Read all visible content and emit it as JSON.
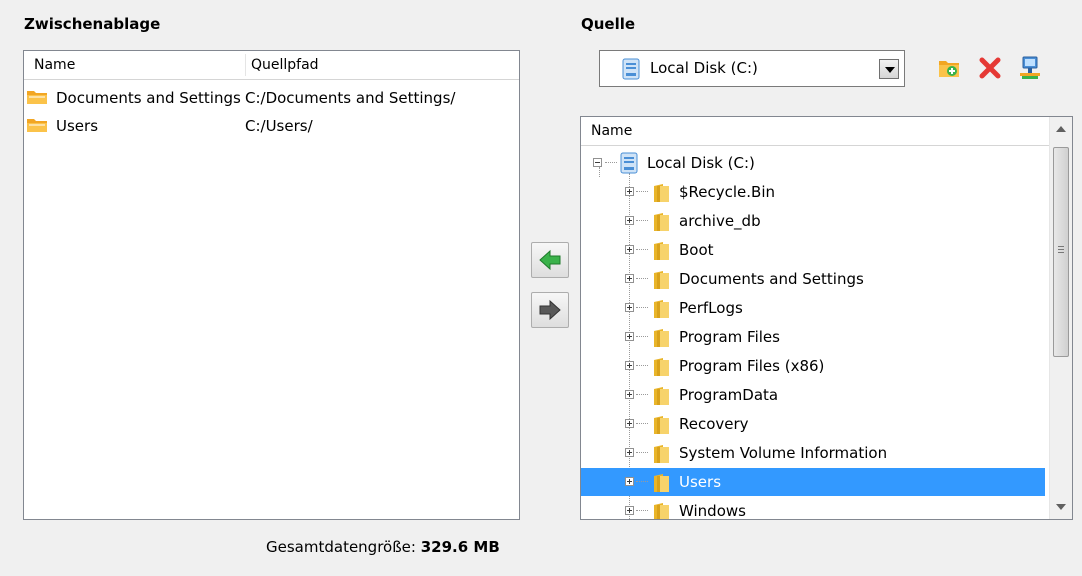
{
  "clipboard": {
    "heading": "Zwischenablage",
    "columns": {
      "name": "Name",
      "source_path": "Quellpfad"
    },
    "items": [
      {
        "name": "Documents and Settings",
        "path": "C:/Documents and Settings/"
      },
      {
        "name": "Users",
        "path": "C:/Users/"
      }
    ],
    "total_label": "Gesamtdatengröße:",
    "total_value": "329.6 MB"
  },
  "source": {
    "heading": "Quelle",
    "drive_select": {
      "selected": "Local Disk (C:)"
    },
    "toolbar": [
      "add-folder-icon",
      "delete-icon",
      "network-icon"
    ],
    "tree_header": "Name",
    "root": "Local Disk (C:)",
    "folders": [
      "$Recycle.Bin",
      "archive_db",
      "Boot",
      "Documents and Settings",
      "PerfLogs",
      "Program Files",
      "Program Files (x86)",
      "ProgramData",
      "Recovery",
      "System Volume Information",
      "Users",
      "Windows"
    ],
    "selected_folder": "Users"
  },
  "colors": {
    "selection": "#3399ff",
    "add_arrow": "#3ab24a",
    "delete": "#e53935"
  }
}
